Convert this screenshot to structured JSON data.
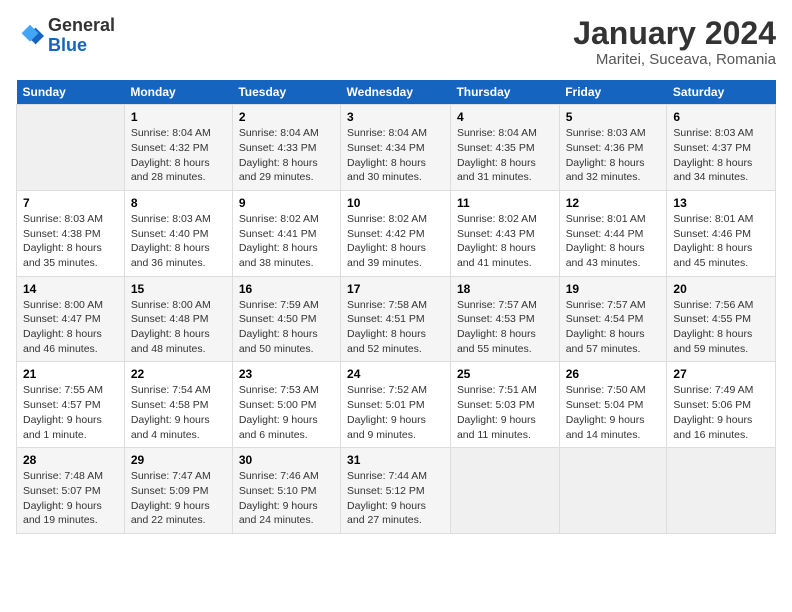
{
  "header": {
    "logo_line1": "General",
    "logo_line2": "Blue",
    "title": "January 2024",
    "subtitle": "Maritei, Suceava, Romania"
  },
  "weekdays": [
    "Sunday",
    "Monday",
    "Tuesday",
    "Wednesday",
    "Thursday",
    "Friday",
    "Saturday"
  ],
  "weeks": [
    [
      {
        "day": "",
        "info": ""
      },
      {
        "day": "1",
        "info": "Sunrise: 8:04 AM\nSunset: 4:32 PM\nDaylight: 8 hours\nand 28 minutes."
      },
      {
        "day": "2",
        "info": "Sunrise: 8:04 AM\nSunset: 4:33 PM\nDaylight: 8 hours\nand 29 minutes."
      },
      {
        "day": "3",
        "info": "Sunrise: 8:04 AM\nSunset: 4:34 PM\nDaylight: 8 hours\nand 30 minutes."
      },
      {
        "day": "4",
        "info": "Sunrise: 8:04 AM\nSunset: 4:35 PM\nDaylight: 8 hours\nand 31 minutes."
      },
      {
        "day": "5",
        "info": "Sunrise: 8:03 AM\nSunset: 4:36 PM\nDaylight: 8 hours\nand 32 minutes."
      },
      {
        "day": "6",
        "info": "Sunrise: 8:03 AM\nSunset: 4:37 PM\nDaylight: 8 hours\nand 34 minutes."
      }
    ],
    [
      {
        "day": "7",
        "info": "Sunrise: 8:03 AM\nSunset: 4:38 PM\nDaylight: 8 hours\nand 35 minutes."
      },
      {
        "day": "8",
        "info": "Sunrise: 8:03 AM\nSunset: 4:40 PM\nDaylight: 8 hours\nand 36 minutes."
      },
      {
        "day": "9",
        "info": "Sunrise: 8:02 AM\nSunset: 4:41 PM\nDaylight: 8 hours\nand 38 minutes."
      },
      {
        "day": "10",
        "info": "Sunrise: 8:02 AM\nSunset: 4:42 PM\nDaylight: 8 hours\nand 39 minutes."
      },
      {
        "day": "11",
        "info": "Sunrise: 8:02 AM\nSunset: 4:43 PM\nDaylight: 8 hours\nand 41 minutes."
      },
      {
        "day": "12",
        "info": "Sunrise: 8:01 AM\nSunset: 4:44 PM\nDaylight: 8 hours\nand 43 minutes."
      },
      {
        "day": "13",
        "info": "Sunrise: 8:01 AM\nSunset: 4:46 PM\nDaylight: 8 hours\nand 45 minutes."
      }
    ],
    [
      {
        "day": "14",
        "info": "Sunrise: 8:00 AM\nSunset: 4:47 PM\nDaylight: 8 hours\nand 46 minutes."
      },
      {
        "day": "15",
        "info": "Sunrise: 8:00 AM\nSunset: 4:48 PM\nDaylight: 8 hours\nand 48 minutes."
      },
      {
        "day": "16",
        "info": "Sunrise: 7:59 AM\nSunset: 4:50 PM\nDaylight: 8 hours\nand 50 minutes."
      },
      {
        "day": "17",
        "info": "Sunrise: 7:58 AM\nSunset: 4:51 PM\nDaylight: 8 hours\nand 52 minutes."
      },
      {
        "day": "18",
        "info": "Sunrise: 7:57 AM\nSunset: 4:53 PM\nDaylight: 8 hours\nand 55 minutes."
      },
      {
        "day": "19",
        "info": "Sunrise: 7:57 AM\nSunset: 4:54 PM\nDaylight: 8 hours\nand 57 minutes."
      },
      {
        "day": "20",
        "info": "Sunrise: 7:56 AM\nSunset: 4:55 PM\nDaylight: 8 hours\nand 59 minutes."
      }
    ],
    [
      {
        "day": "21",
        "info": "Sunrise: 7:55 AM\nSunset: 4:57 PM\nDaylight: 9 hours\nand 1 minute."
      },
      {
        "day": "22",
        "info": "Sunrise: 7:54 AM\nSunset: 4:58 PM\nDaylight: 9 hours\nand 4 minutes."
      },
      {
        "day": "23",
        "info": "Sunrise: 7:53 AM\nSunset: 5:00 PM\nDaylight: 9 hours\nand 6 minutes."
      },
      {
        "day": "24",
        "info": "Sunrise: 7:52 AM\nSunset: 5:01 PM\nDaylight: 9 hours\nand 9 minutes."
      },
      {
        "day": "25",
        "info": "Sunrise: 7:51 AM\nSunset: 5:03 PM\nDaylight: 9 hours\nand 11 minutes."
      },
      {
        "day": "26",
        "info": "Sunrise: 7:50 AM\nSunset: 5:04 PM\nDaylight: 9 hours\nand 14 minutes."
      },
      {
        "day": "27",
        "info": "Sunrise: 7:49 AM\nSunset: 5:06 PM\nDaylight: 9 hours\nand 16 minutes."
      }
    ],
    [
      {
        "day": "28",
        "info": "Sunrise: 7:48 AM\nSunset: 5:07 PM\nDaylight: 9 hours\nand 19 minutes."
      },
      {
        "day": "29",
        "info": "Sunrise: 7:47 AM\nSunset: 5:09 PM\nDaylight: 9 hours\nand 22 minutes."
      },
      {
        "day": "30",
        "info": "Sunrise: 7:46 AM\nSunset: 5:10 PM\nDaylight: 9 hours\nand 24 minutes."
      },
      {
        "day": "31",
        "info": "Sunrise: 7:44 AM\nSunset: 5:12 PM\nDaylight: 9 hours\nand 27 minutes."
      },
      {
        "day": "",
        "info": ""
      },
      {
        "day": "",
        "info": ""
      },
      {
        "day": "",
        "info": ""
      }
    ]
  ]
}
